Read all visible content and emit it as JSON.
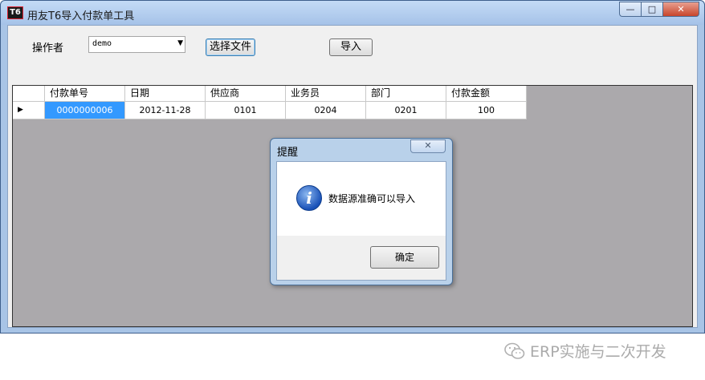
{
  "window": {
    "icon_text": "T6",
    "title": "用友T6导入付款单工具",
    "controls": {
      "minimize": "—",
      "maximize": "□",
      "close": "✕"
    }
  },
  "toolbar": {
    "operator_label": "操作者",
    "operator_value": "demo",
    "choose_file_label": "选择文件",
    "import_label": "导入"
  },
  "grid": {
    "columns": [
      "付款单号",
      "日期",
      "供应商",
      "业务员",
      "部门",
      "付款金额"
    ],
    "rows": [
      {
        "marker": "▶",
        "cells": [
          "0000000006",
          "2012-11-28",
          "0101",
          "0204",
          "0201",
          "100"
        ]
      }
    ]
  },
  "dialog": {
    "title": "提醒",
    "close": "✕",
    "icon": "info-icon",
    "message": "数据源准确可以导入",
    "ok_label": "确定"
  },
  "watermark": {
    "text": "ERP实施与二次开发"
  },
  "colors": {
    "selection": "#3399ff",
    "grid_bg": "#aba9ac",
    "titlebar": "#b9d1ea"
  }
}
